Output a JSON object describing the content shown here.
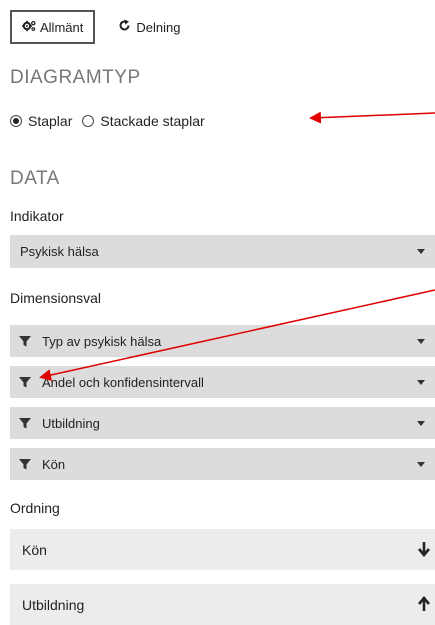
{
  "tabs": [
    {
      "label": "Allmänt",
      "icon": "gears-icon",
      "active": true
    },
    {
      "label": "Delning",
      "icon": "share-icon",
      "active": false
    }
  ],
  "chart_type": {
    "title": "DIAGRAMTYP",
    "options": [
      {
        "label": "Staplar",
        "checked": true
      },
      {
        "label": "Stackade staplar",
        "checked": false
      }
    ]
  },
  "data_section": {
    "title": "DATA",
    "indicator_label": "Indikator",
    "indicator_value": "Psykisk hälsa",
    "dimensions_label": "Dimensionsval",
    "dimensions": [
      "Typ av psykisk hälsa",
      "Andel och konfidensintervall",
      "Utbildning",
      "Kön"
    ],
    "ordering_label": "Ordning",
    "ordering": [
      {
        "label": "Kön",
        "direction": "down"
      },
      {
        "label": "Utbildning",
        "direction": "up"
      }
    ]
  },
  "colors": {
    "annotation_arrow": "#e00000",
    "select_bg": "#dcdcdc",
    "order_bg": "#ececec"
  }
}
